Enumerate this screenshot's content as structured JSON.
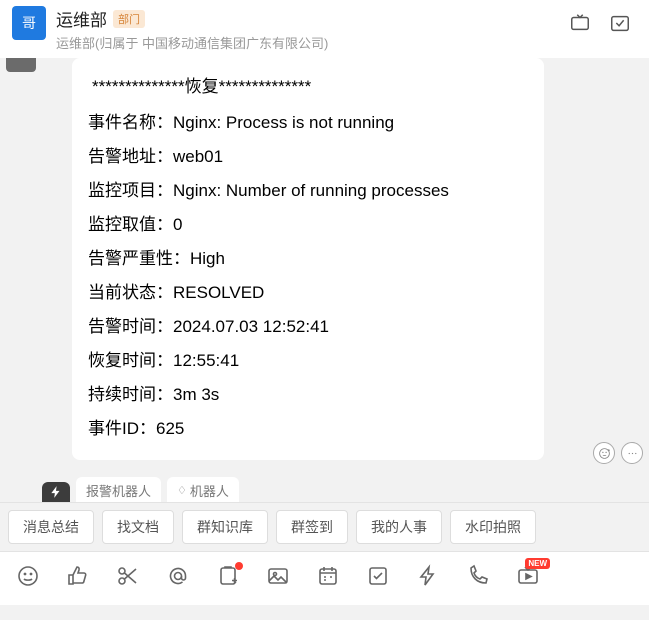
{
  "header": {
    "avatar_text": "哥",
    "title": "运维部",
    "badge": "部门",
    "subtitle": "运维部(归属于 中国移动通信集团广东有限公司)"
  },
  "message": {
    "title": "**************恢复**************",
    "fields": [
      {
        "label": "事件名称：",
        "value": "Nginx: Process is not running"
      },
      {
        "label": "告警地址：",
        "value": "web01"
      },
      {
        "label": "监控项目：",
        "value": "Nginx: Number of running processes"
      },
      {
        "label": "监控取值：",
        "value": "0"
      },
      {
        "label": "告警严重性：",
        "value": "High"
      },
      {
        "label": "当前状态：",
        "value": "RESOLVED"
      },
      {
        "label": "告警时间：",
        "value": "2024.07.03 12:52:41"
      },
      {
        "label": "恢复时间：",
        "value": "12:55:41"
      },
      {
        "label": "持续时间：",
        "value": "3m 3s"
      },
      {
        "label": "事件ID：",
        "value": "625"
      }
    ]
  },
  "tags": {
    "alarm_bot": "报警机器人",
    "bot": "机器人"
  },
  "quick": [
    "消息总结",
    "找文档",
    "群知识库",
    "群签到",
    "我的人事",
    "水印拍照"
  ],
  "toolbar": {
    "new_label": "NEW"
  }
}
